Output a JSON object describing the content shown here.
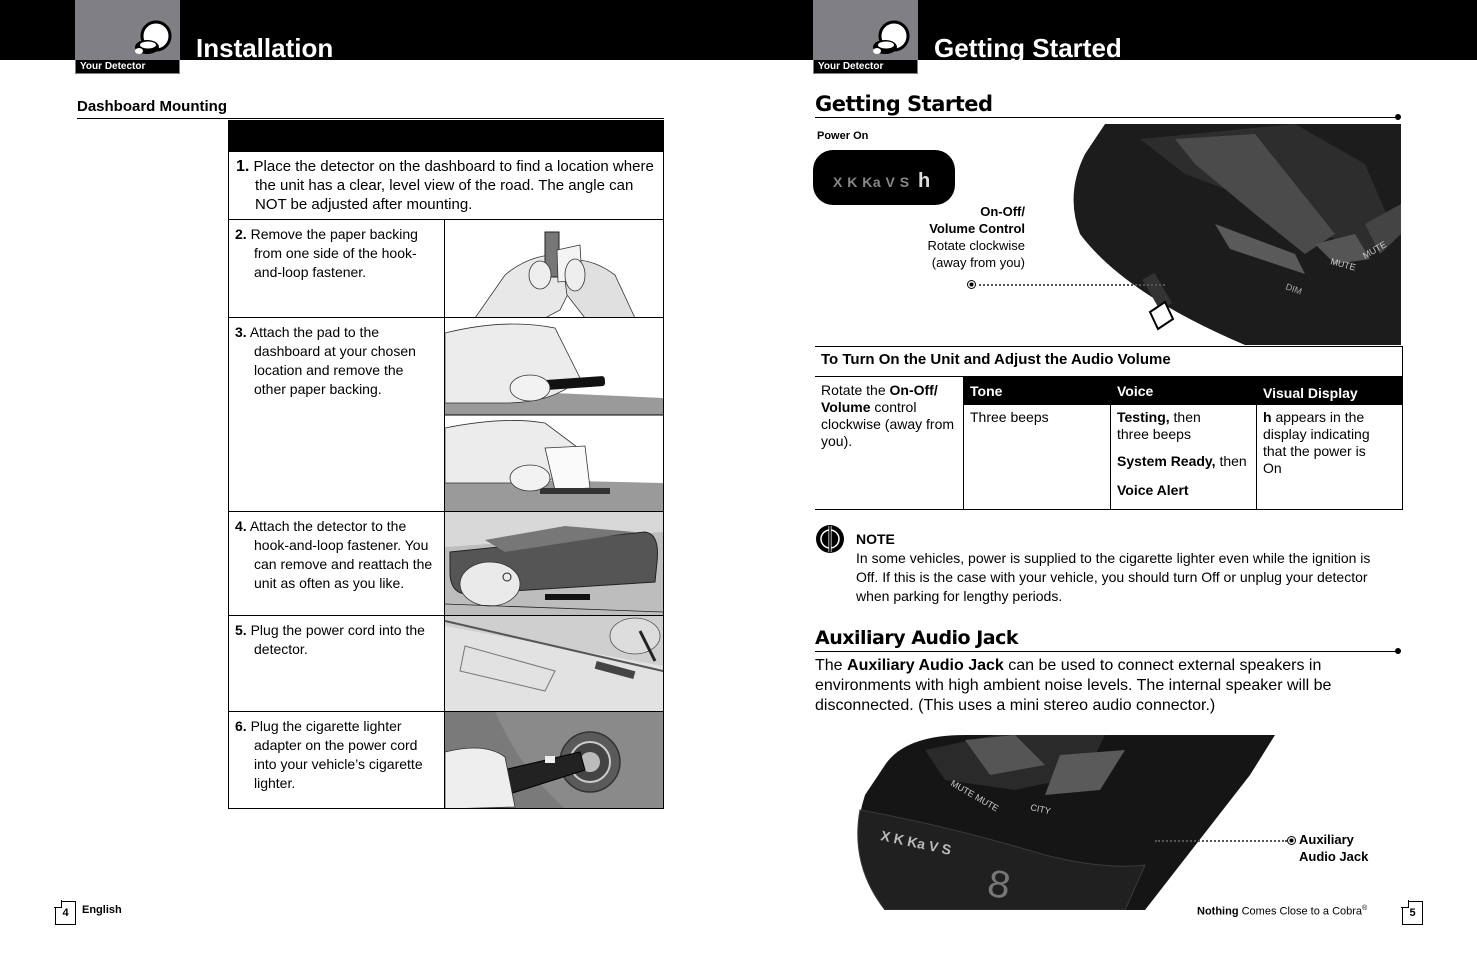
{
  "left_page": {
    "tab_label": "Your Detector",
    "header_title": "Installation",
    "section_title": "Dashboard Mounting",
    "steps": [
      {
        "num": "1.",
        "text": "Place the detector on the dashboard to find a location where the unit has a clear, level view of the road. The angle can NOT be adjusted after mounting."
      },
      {
        "num": "2.",
        "text": "Remove the paper backing from one side of the hook-and-loop fastener."
      },
      {
        "num": "3.",
        "text": "Attach the pad to the dashboard at your chosen location and remove the other paper backing."
      },
      {
        "num": "4.",
        "text": "Attach the detector to the hook-and-loop fastener. You can remove and reattach the unit as often as you like."
      },
      {
        "num": "5.",
        "text": "Plug the power cord into the detector."
      },
      {
        "num": "6.",
        "text": "Plug the cigarette lighter adapter on the power cord into your vehicle’s cigarette lighter."
      }
    ],
    "footer": {
      "page_number": "4",
      "language": "English"
    }
  },
  "right_page": {
    "tab_label": "Your Detector",
    "header_title": "Getting Started",
    "section_title": "Getting Started",
    "power_on_label": "Power On",
    "display_bands": "X K Ka V S",
    "display_glyph": "h",
    "callout": {
      "title_line1": "On-Off/",
      "title_line2": "Volume Control",
      "desc_line1": "Rotate clockwise",
      "desc_line2": "(away from you)"
    },
    "device_labels": {
      "dim": "DIM",
      "mute1": "MUTE",
      "mute2": "MUTE",
      "city": "CITY",
      "digit": "8",
      "bands": "X K Ka V S"
    },
    "table": {
      "caption": "To Turn On the Unit and Adjust the Audio Volume",
      "instruction_prefix": "Rotate the ",
      "instruction_bold1": "On-Off/",
      "instruction_bold2": "Volume",
      "instruction_suffix": " control clockwise (away from you).",
      "headers": [
        "Tone",
        "Voice",
        "Visual Display"
      ],
      "tone": "Three beeps",
      "voice": [
        {
          "bold": "Testing,",
          "rest": " then three beeps"
        },
        {
          "bold": "System Ready,",
          "rest": " then"
        },
        {
          "bold": "Voice Alert",
          "rest": ""
        }
      ],
      "visual_glyph": "h",
      "visual_text": " appears in the display indicating that the power is On"
    },
    "note": {
      "title": "NOTE",
      "text": "In some vehicles, power is supplied to the cigarette lighter even while the ignition is Off. If this is the case with your vehicle, you should turn Off or unplug your detector when parking for lengthy periods."
    },
    "aux_section": {
      "title": "Auxiliary Audio Jack",
      "para_prefix": "The ",
      "para_bold": "Auxiliary Audio Jack",
      "para_rest": " can be used to connect external speakers in environments with high ambient noise levels. The internal speaker will be disconnected. (This uses a mini stereo audio connector.)",
      "callout_line1": "Auxiliary",
      "callout_line2": "Audio Jack"
    },
    "footer": {
      "tagline_bold": "Nothing",
      "tagline_rest": " Comes Close to a Cobra",
      "registered": "®",
      "page_number": "5"
    }
  },
  "colors": {
    "tab_gray": "#7f7f84",
    "header_black": "#000000"
  }
}
